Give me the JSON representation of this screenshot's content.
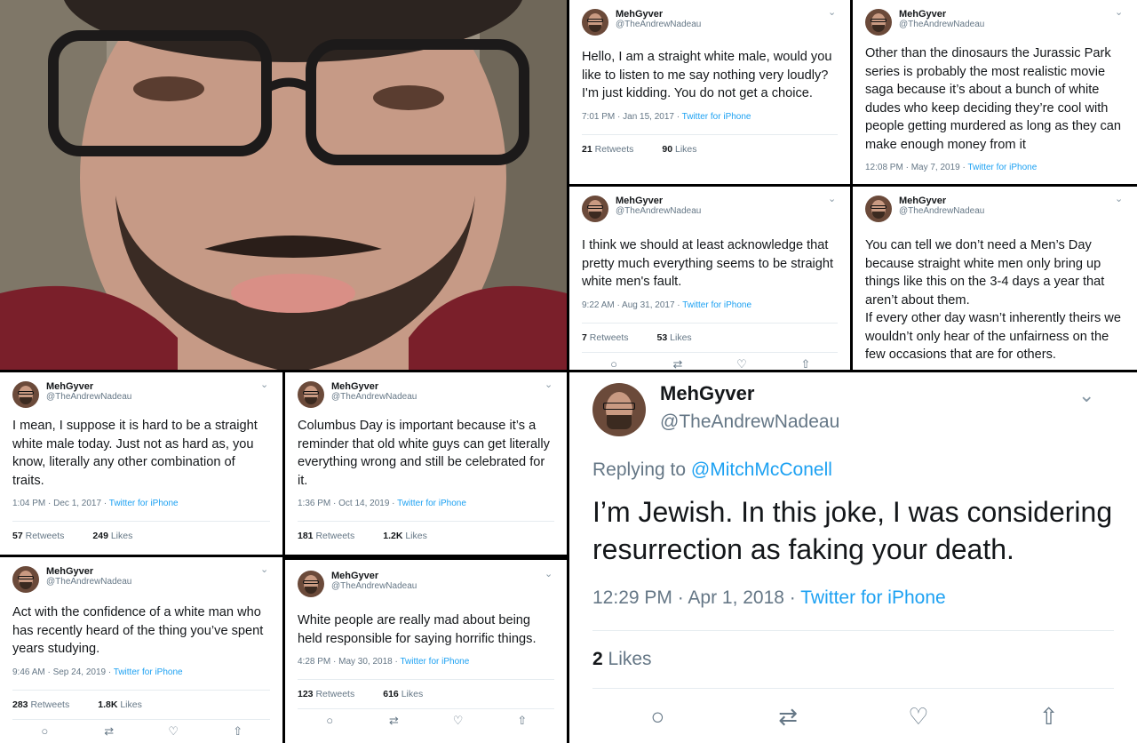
{
  "photo": {
    "alt_icon": "selfie-photo"
  },
  "common": {
    "name": "MehGyver",
    "handle": "@TheAndrewNadeau",
    "chevron": "⌄",
    "retweets_label": "Retweets",
    "likes_label": "Likes"
  },
  "tweets": [
    {
      "body": "Hello, I am a straight white male, would you like to listen to me say nothing very loudly?\nI'm just kidding. You do not get a choice.",
      "time": "7:01 PM · Jan 15, 2017 · ",
      "source": "Twitter for iPhone",
      "retweets": "21",
      "likes": "90"
    },
    {
      "body": "Other than the dinosaurs the Jurassic Park series is probably the most realistic movie saga because it’s about a bunch of white dudes who keep deciding they’re cool with people getting murdered as long as they can make enough money from it",
      "time": "12:08 PM · May 7, 2019 · ",
      "source": "Twitter for iPhone"
    },
    {
      "body": "I think we should at least acknowledge that pretty much everything seems to be straight white men's fault.",
      "time": "9:22 AM · Aug 31, 2017 · ",
      "source": "Twitter for iPhone",
      "retweets": "7",
      "likes": "53"
    },
    {
      "body": "You can tell we don’t need a Men’s Day because straight white men only bring up things like this on the 3-4 days a year that aren’t about them.\nIf every other day wasn’t inherently theirs we wouldn’t only hear of the unfairness on the few occasions that are for others."
    },
    {
      "body": "I mean, I suppose it is hard to be a straight white male today. Just not as hard as, you know, literally any other combination of traits.",
      "time": "1:04 PM · Dec 1, 2017 · ",
      "source": "Twitter for iPhone",
      "retweets": "57",
      "likes": "249"
    },
    {
      "body": "Columbus Day is important because it’s a reminder that old white guys can get literally everything wrong and still be celebrated for it.",
      "time": "1:36 PM · Oct 14, 2019 · ",
      "source": "Twitter for iPhone",
      "retweets": "181",
      "likes": "1.2K"
    },
    {
      "body": "Act with the confidence of a white man who has recently heard of the thing you’ve spent years studying.",
      "time": "9:46 AM · Sep 24, 2019 · ",
      "source": "Twitter for iPhone",
      "retweets": "283",
      "likes": "1.8K"
    },
    {
      "body": "White people are really mad about being held responsible for saying horrific things.",
      "time": "4:28 PM · May 30, 2018 · ",
      "source": "Twitter for iPhone",
      "retweets": "123",
      "likes": "616"
    }
  ],
  "big": {
    "replying": "Replying to ",
    "reply_to": "@MitchMcConell",
    "body": "I’m Jewish. In this joke, I was considering resurrection as faking your death.",
    "time": "12:29 PM · Apr 1, 2018 · ",
    "source": "Twitter for iPhone",
    "likes": "2",
    "likes_label": " Likes"
  },
  "icons": {
    "reply": "○",
    "retweet": "⇄",
    "like": "♡",
    "share": "⇧"
  }
}
